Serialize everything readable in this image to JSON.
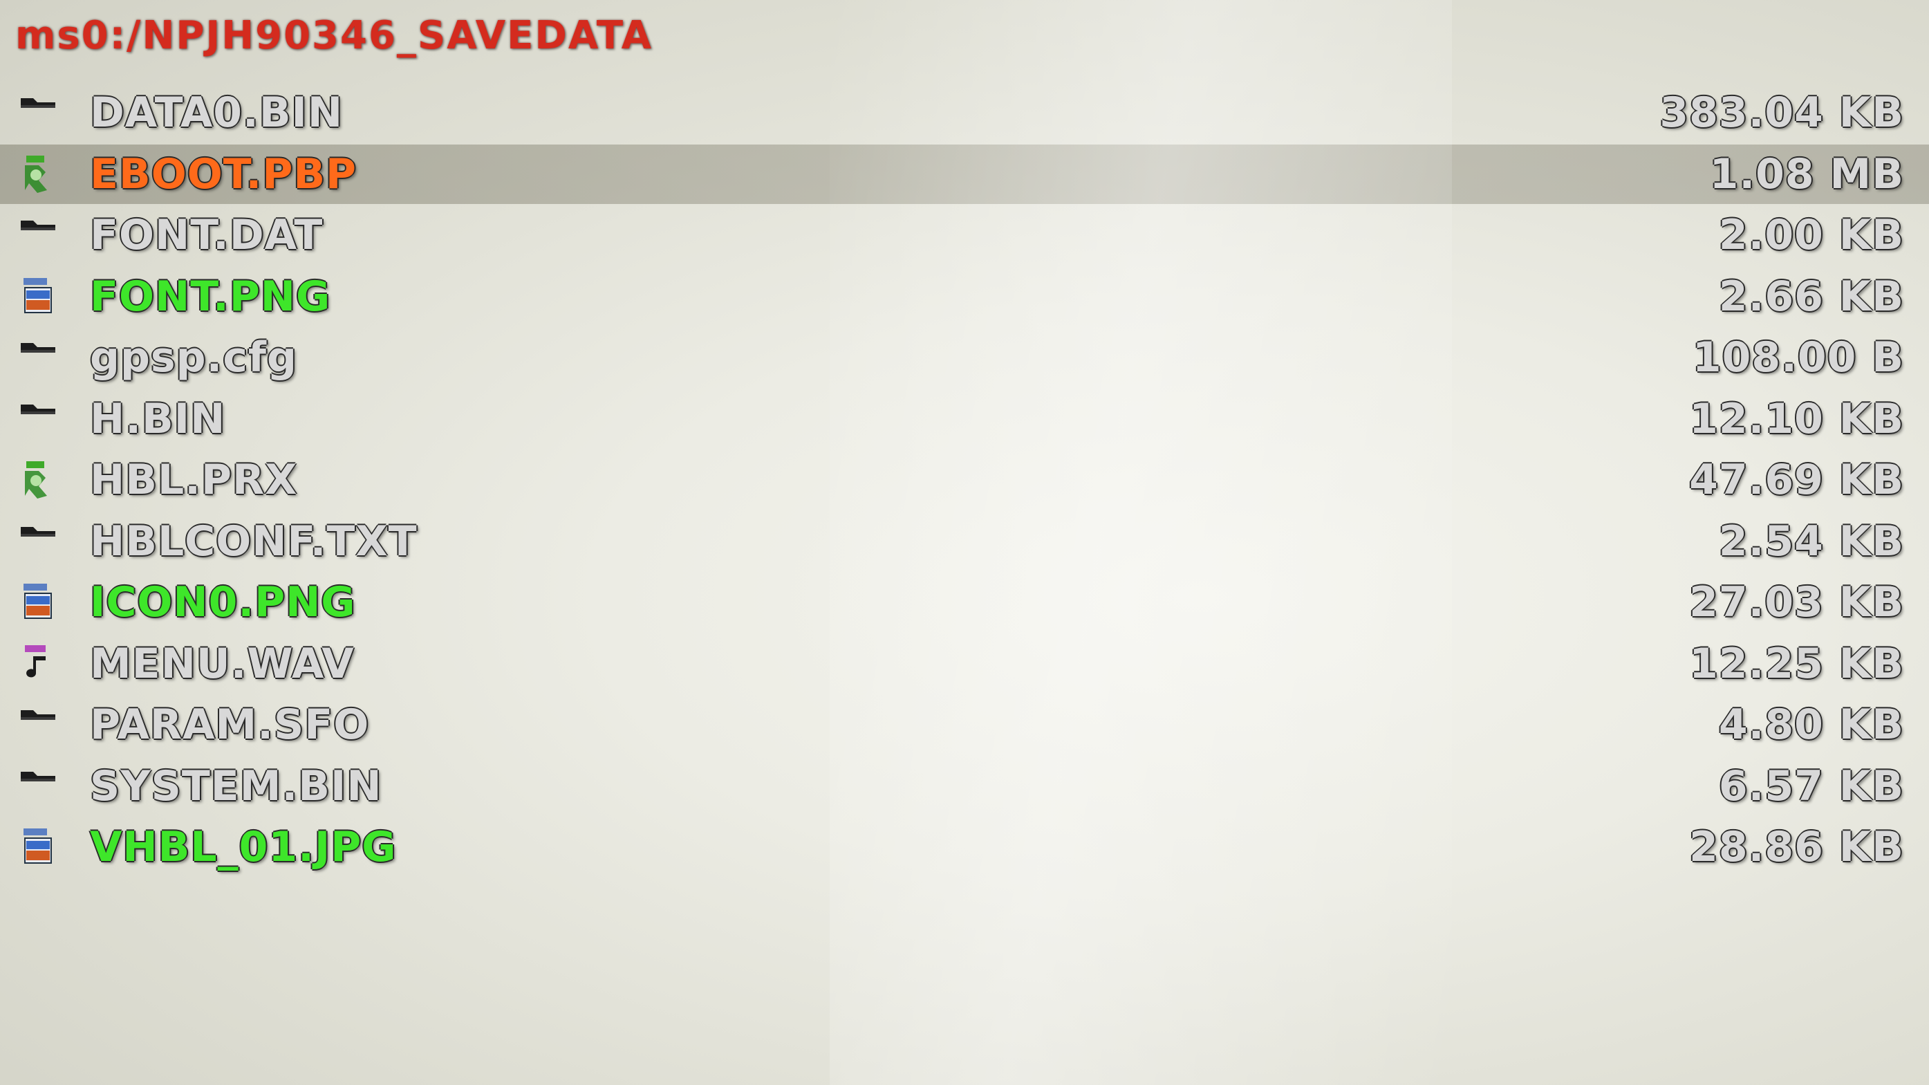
{
  "path": {
    "text": "ms0:/NPJH90346_SAVEDATA",
    "color": "#d42b1e"
  },
  "colors": {
    "default_text": "#d8d8d8",
    "selected_text": "#ff6a1a",
    "image_text": "#3ee62a"
  },
  "files": [
    {
      "name": "DATA0.BIN",
      "size": "383.04 KB",
      "icon": "file-icon",
      "type": "file",
      "selected": false
    },
    {
      "name": "EBOOT.PBP",
      "size": "1.08 MB",
      "icon": "executable-icon",
      "type": "executable",
      "selected": true
    },
    {
      "name": "FONT.DAT",
      "size": "2.00 KB",
      "icon": "file-icon",
      "type": "file",
      "selected": false
    },
    {
      "name": "FONT.PNG",
      "size": "2.66 KB",
      "icon": "image-icon",
      "type": "image",
      "selected": false
    },
    {
      "name": "gpsp.cfg",
      "size": "108.00 B",
      "icon": "file-icon",
      "type": "file",
      "selected": false
    },
    {
      "name": "H.BIN",
      "size": "12.10 KB",
      "icon": "file-icon",
      "type": "file",
      "selected": false
    },
    {
      "name": "HBL.PRX",
      "size": "47.69 KB",
      "icon": "executable-icon",
      "type": "executable",
      "selected": false
    },
    {
      "name": "HBLCONF.TXT",
      "size": "2.54 KB",
      "icon": "file-icon",
      "type": "file",
      "selected": false
    },
    {
      "name": "ICON0.PNG",
      "size": "27.03 KB",
      "icon": "image-icon",
      "type": "image",
      "selected": false
    },
    {
      "name": "MENU.WAV",
      "size": "12.25 KB",
      "icon": "music-icon",
      "type": "audio",
      "selected": false
    },
    {
      "name": "PARAM.SFO",
      "size": "4.80 KB",
      "icon": "file-icon",
      "type": "file",
      "selected": false
    },
    {
      "name": "SYSTEM.BIN",
      "size": "6.57 KB",
      "icon": "file-icon",
      "type": "file",
      "selected": false
    },
    {
      "name": "VHBL_01.JPG",
      "size": "28.86 KB",
      "icon": "image-icon",
      "type": "image",
      "selected": false
    }
  ]
}
